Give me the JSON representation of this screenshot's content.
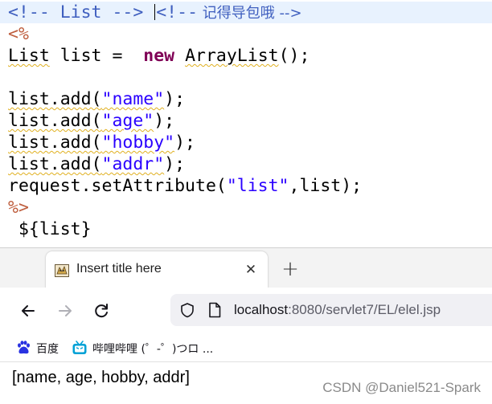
{
  "editor": {
    "line1": {
      "comment1": "<!-- List -->",
      "comment2": "<!--",
      "comment3": " 记得导包哦 -->"
    },
    "line2": {
      "scriptlet_open": "<%"
    },
    "line3": {
      "type": "List",
      "var": " list = ",
      "kw": "new",
      "ctor": "ArrayList",
      "rest": "();"
    },
    "line5": {
      "call": "list.add(",
      "arg": "\"name\"",
      "end": ");"
    },
    "line6": {
      "call": "list.add(",
      "arg": "\"age\"",
      "end": ");"
    },
    "line7": {
      "call": "list.add(",
      "arg": "\"hobby\"",
      "end": ");"
    },
    "line8": {
      "call": "list.add(",
      "arg": "\"addr\"",
      "end": ");"
    },
    "line9": {
      "call": "request.setAttribute(",
      "arg": "\"list\"",
      "end": ",list);"
    },
    "line10": {
      "scriptlet_close": "%>"
    },
    "line11": {
      "el": " ${list}"
    }
  },
  "browser": {
    "tab": {
      "title": "Insert title here",
      "close": "✕"
    },
    "new_tab": "+",
    "url": {
      "host": "localhost",
      "rest": ":8080/servlet7/EL/elel.jsp"
    },
    "bookmarks": [
      {
        "label": "百度",
        "icon": "baidu-paw-icon"
      },
      {
        "label": "哔哩哔哩 (゜-゜)つロ ...",
        "icon": "bilibili-tv-icon"
      }
    ],
    "page_output": "[name, age, hobby, addr]",
    "watermark": "CSDN @Daniel521-Spark"
  },
  "colors": {
    "comment": "#3f5fbf",
    "jsp_tag": "#bf5f3f",
    "keyword": "#7f0055",
    "string": "#2a00ff",
    "bilibili": "#00a1d6",
    "baidu": "#2932e1"
  }
}
